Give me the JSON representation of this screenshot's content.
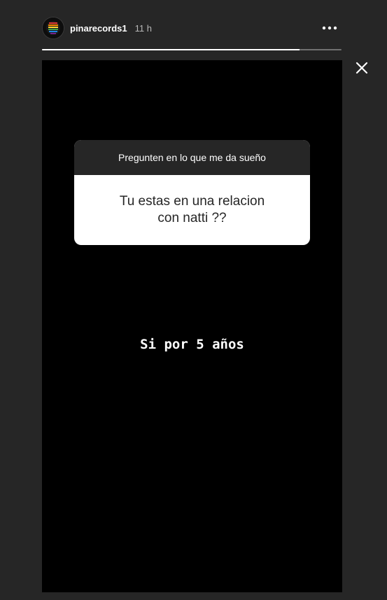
{
  "header": {
    "avatar_icon": "profile-avatar-icon",
    "username": "pinarecords1",
    "timestamp": "11 h",
    "more_icon": "more-options-icon"
  },
  "progress": {
    "segments": 1,
    "current_fraction": 0.86
  },
  "controls": {
    "close_icon": "close-icon"
  },
  "question_sticker": {
    "prompt": "Pregunten en lo que me da sueño",
    "question": "Tu estas en una relacion\ncon natti ??"
  },
  "story": {
    "answer_text": "Si por 5 años"
  },
  "colors": {
    "page_background": "#262626",
    "story_background": "#000000",
    "sticker_header": "#262626",
    "sticker_body": "#ffffff",
    "text_primary": "#ffffff"
  }
}
